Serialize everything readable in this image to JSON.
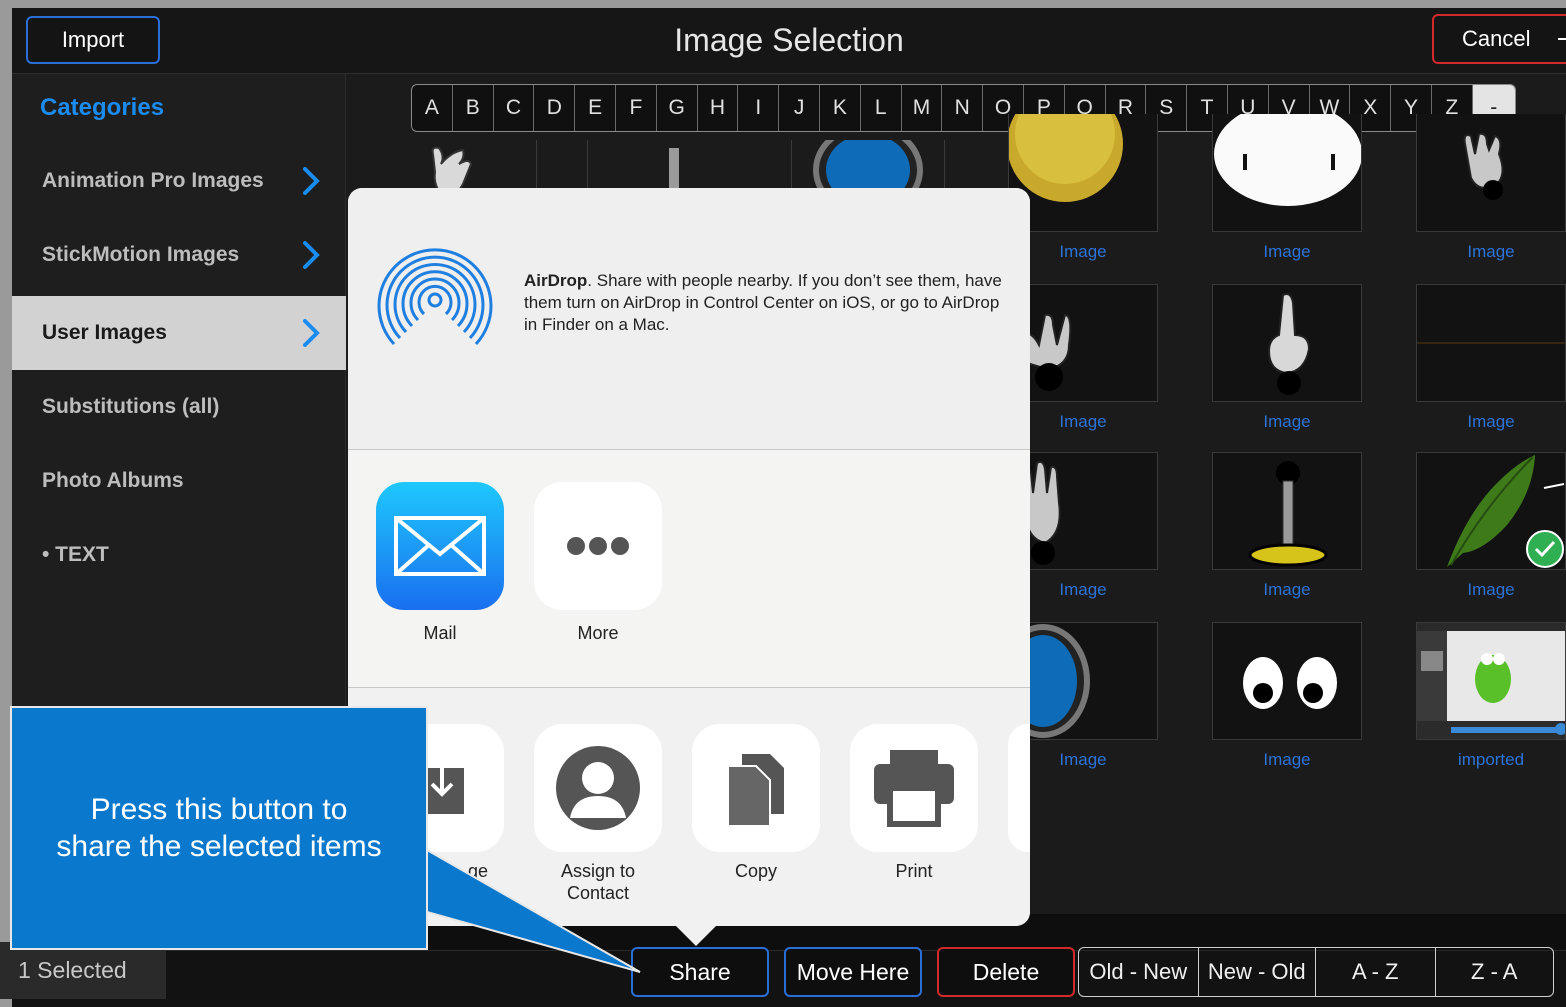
{
  "header": {
    "import_label": "Import",
    "title": "Image Selection",
    "cancel_label": "Cancel"
  },
  "sidebar": {
    "heading": "Categories",
    "items": [
      {
        "label": "Animation Pro Images",
        "has_chevron": true,
        "active": false
      },
      {
        "label": "StickMotion Images",
        "has_chevron": true,
        "active": false
      },
      {
        "label": "User Images",
        "has_chevron": true,
        "active": true
      },
      {
        "label": "Substitutions (all)",
        "has_chevron": false,
        "active": false
      },
      {
        "label": "Photo Albums",
        "has_chevron": false,
        "active": false
      },
      {
        "label": "• TEXT",
        "has_chevron": false,
        "active": false
      }
    ]
  },
  "alphabet": [
    "A",
    "B",
    "C",
    "D",
    "E",
    "F",
    "G",
    "H",
    "I",
    "J",
    "K",
    "L",
    "M",
    "N",
    "O",
    "P",
    "Q",
    "R",
    "S",
    "T",
    "U",
    "V",
    "W",
    "X",
    "Y",
    "Z",
    "-"
  ],
  "grid": {
    "labels": {
      "row1": [
        "Image",
        "Image",
        "Image"
      ],
      "row2": [
        "Image",
        "Image",
        "Image"
      ],
      "row3": [
        "Image",
        "Image",
        "Image"
      ],
      "row4": [
        "Image",
        "Image",
        "imported"
      ]
    }
  },
  "share_sheet": {
    "airdrop_title": "AirDrop",
    "airdrop_text": ". Share with people nearby. If you don’t see them, have them turn on AirDrop in Control Center on iOS, or go to AirDrop in Finder on a Mac.",
    "apps": [
      {
        "label": "Mail",
        "icon": "mail-icon"
      },
      {
        "label": "More",
        "icon": "more-icon"
      }
    ],
    "actions": [
      {
        "label": "ge",
        "icon": "save-image-icon"
      },
      {
        "label": "Assign to\nContact",
        "icon": "contact-icon"
      },
      {
        "label": "Copy",
        "icon": "copy-icon"
      },
      {
        "label": "Print",
        "icon": "print-icon"
      }
    ]
  },
  "bottom": {
    "selected_label": "1 Selected",
    "share_label": "Share",
    "move_label": "Move Here",
    "delete_label": "Delete",
    "sort_options": [
      "Old - New",
      "New - Old",
      "A - Z",
      "Z - A"
    ]
  },
  "callout": {
    "text": "Press this button to share the selected items"
  },
  "colors": {
    "accent_blue": "#1a8cf0",
    "cancel_red": "#d12a2a",
    "callout_blue": "#0a78cc",
    "check_green": "#2fae52"
  }
}
